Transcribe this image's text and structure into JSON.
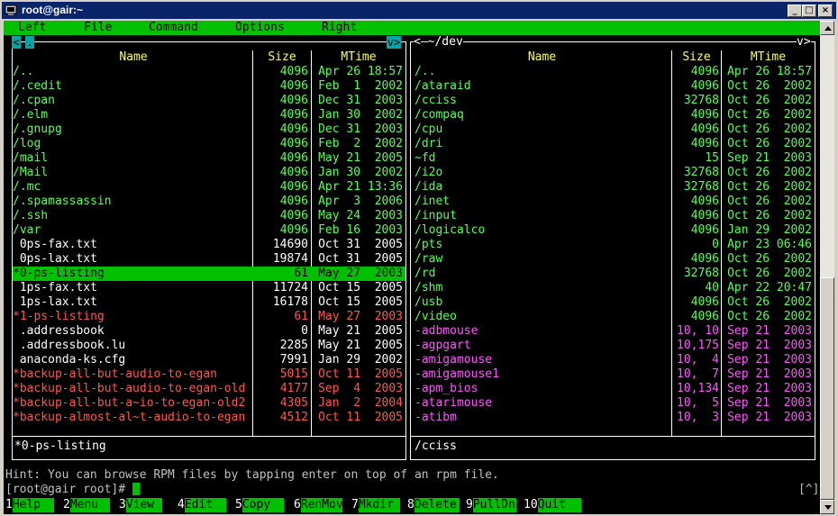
{
  "window": {
    "title": "root@gair:~",
    "buttons": {
      "minimize": "_",
      "maximize": "□",
      "close": "×"
    }
  },
  "menu": [
    "Left",
    "File",
    "Command",
    "Options",
    "Right"
  ],
  "left_panel": {
    "path": "",
    "header": {
      "name": "Name",
      "size": "Size",
      "mtime": "MTime"
    },
    "files": [
      {
        "name": "/..",
        "size": "4096",
        "mtime": "Apr 26 18:57",
        "type": "dir"
      },
      {
        "name": "/.cedit",
        "size": "4096",
        "mtime": "Feb  1  2002",
        "type": "dir"
      },
      {
        "name": "/.cpan",
        "size": "4096",
        "mtime": "Dec 31  2003",
        "type": "dir"
      },
      {
        "name": "/.elm",
        "size": "4096",
        "mtime": "Jan 30  2002",
        "type": "dir"
      },
      {
        "name": "/.gnupg",
        "size": "4096",
        "mtime": "Dec 31  2003",
        "type": "dir"
      },
      {
        "name": "/log",
        "size": "4096",
        "mtime": "Feb  2  2002",
        "type": "dir"
      },
      {
        "name": "/mail",
        "size": "4096",
        "mtime": "May 21  2005",
        "type": "dir"
      },
      {
        "name": "/Mail",
        "size": "4096",
        "mtime": "Jan 30  2002",
        "type": "dir"
      },
      {
        "name": "/.mc",
        "size": "4096",
        "mtime": "Apr 21 13:36",
        "type": "dir"
      },
      {
        "name": "/.spamassassin",
        "size": "4096",
        "mtime": "Apr  3  2006",
        "type": "dir"
      },
      {
        "name": "/.ssh",
        "size": "4096",
        "mtime": "May 24  2003",
        "type": "dir"
      },
      {
        "name": "/var",
        "size": "4096",
        "mtime": "Feb 16  2003",
        "type": "dir"
      },
      {
        "name": " 0ps-fax.txt",
        "size": "14690",
        "mtime": "Oct 31  2005",
        "type": "file"
      },
      {
        "name": " 0ps-lax.txt",
        "size": "19874",
        "mtime": "Oct 31  2005",
        "type": "file"
      },
      {
        "name": "*0-ps-listing",
        "size": "61",
        "mtime": "May 27  2003",
        "type": "selected"
      },
      {
        "name": " 1ps-fax.txt",
        "size": "11724",
        "mtime": "Oct 15  2005",
        "type": "file"
      },
      {
        "name": " 1ps-lax.txt",
        "size": "16178",
        "mtime": "Oct 15  2005",
        "type": "file"
      },
      {
        "name": "*1-ps-listing",
        "size": "61",
        "mtime": "May 27  2003",
        "type": "exec"
      },
      {
        "name": " .addressbook",
        "size": "0",
        "mtime": "May 21  2005",
        "type": "file"
      },
      {
        "name": " .addressbook.lu",
        "size": "2285",
        "mtime": "May 21  2005",
        "type": "file"
      },
      {
        "name": " anaconda-ks.cfg",
        "size": "7991",
        "mtime": "Jan 29  2002",
        "type": "file"
      },
      {
        "name": "*backup-all-but-audio-to-egan",
        "size": "5015",
        "mtime": "Oct 11  2005",
        "type": "exec"
      },
      {
        "name": "*backup-all-but-audio-to-egan-old",
        "size": "4177",
        "mtime": "Sep  4  2003",
        "type": "exec"
      },
      {
        "name": "*backup-all-but-a~io-to-egan-old2",
        "size": "4305",
        "mtime": "Jan  2  2004",
        "type": "exec"
      },
      {
        "name": "*backup-almost-al~t-audio-to-egan",
        "size": "4512",
        "mtime": "Oct 11  2005",
        "type": "exec"
      }
    ],
    "status": "*0-ps-listing"
  },
  "right_panel": {
    "path": "~/dev",
    "header": {
      "name": "Name",
      "size": "Size",
      "mtime": "MTime"
    },
    "files": [
      {
        "name": "/..",
        "size": "4096",
        "mtime": "Apr 26 18:57",
        "type": "dir"
      },
      {
        "name": "/ataraid",
        "size": "4096",
        "mtime": "Oct 26  2002",
        "type": "dir"
      },
      {
        "name": "/cciss",
        "size": "32768",
        "mtime": "Oct 26  2002",
        "type": "dir"
      },
      {
        "name": "/compaq",
        "size": "4096",
        "mtime": "Oct 26  2002",
        "type": "dir"
      },
      {
        "name": "/cpu",
        "size": "4096",
        "mtime": "Oct 26  2002",
        "type": "dir"
      },
      {
        "name": "/dri",
        "size": "4096",
        "mtime": "Oct 26  2002",
        "type": "dir"
      },
      {
        "name": "~fd",
        "size": "15",
        "mtime": "Sep 21  2003",
        "type": "dir"
      },
      {
        "name": "/i2o",
        "size": "32768",
        "mtime": "Oct 26  2002",
        "type": "dir"
      },
      {
        "name": "/ida",
        "size": "32768",
        "mtime": "Oct 26  2002",
        "type": "dir"
      },
      {
        "name": "/inet",
        "size": "4096",
        "mtime": "Oct 26  2002",
        "type": "dir"
      },
      {
        "name": "/input",
        "size": "4096",
        "mtime": "Oct 26  2002",
        "type": "dir"
      },
      {
        "name": "/logicalco",
        "size": "4096",
        "mtime": "Jan 29  2002",
        "type": "dir"
      },
      {
        "name": "/pts",
        "size": "0",
        "mtime": "Apr 23 06:46",
        "type": "dir"
      },
      {
        "name": "/raw",
        "size": "4096",
        "mtime": "Oct 26  2002",
        "type": "dir"
      },
      {
        "name": "/rd",
        "size": "32768",
        "mtime": "Oct 26  2002",
        "type": "dir"
      },
      {
        "name": "/shm",
        "size": "40",
        "mtime": "Apr 22 20:47",
        "type": "dir"
      },
      {
        "name": "/usb",
        "size": "4096",
        "mtime": "Oct 26  2002",
        "type": "dir"
      },
      {
        "name": "/video",
        "size": "4096",
        "mtime": "Oct 26  2002",
        "type": "dir"
      },
      {
        "name": "-adbmouse",
        "size": "10, 10",
        "mtime": "Sep 21  2003",
        "type": "dev"
      },
      {
        "name": "-agpgart",
        "size": "10,175",
        "mtime": "Sep 21  2003",
        "type": "dev"
      },
      {
        "name": "-amigamouse",
        "size": "10,  4",
        "mtime": "Sep 21  2003",
        "type": "dev"
      },
      {
        "name": "-amigamouse1",
        "size": "10,  7",
        "mtime": "Sep 21  2003",
        "type": "dev"
      },
      {
        "name": "-apm_bios",
        "size": "10,134",
        "mtime": "Sep 21  2003",
        "type": "dev"
      },
      {
        "name": "-atarimouse",
        "size": "10,  5",
        "mtime": "Sep 21  2003",
        "type": "dev"
      },
      {
        "name": "-atibm",
        "size": "10,  3",
        "mtime": "Sep 21  2003",
        "type": "dev"
      }
    ],
    "status": "/cciss"
  },
  "hint": "Hint: You can browse RPM files by tapping enter on top of an rpm file.",
  "prompt": "[root@gair root]# ",
  "prompt_right": "[^]",
  "fkeys": [
    {
      "num": "1",
      "label": "Help"
    },
    {
      "num": "2",
      "label": "Menu"
    },
    {
      "num": "3",
      "label": "View"
    },
    {
      "num": "4",
      "label": "Edit"
    },
    {
      "num": "5",
      "label": "Copy"
    },
    {
      "num": "6",
      "label": "RenMov"
    },
    {
      "num": "7",
      "label": "Mkdir"
    },
    {
      "num": "8",
      "label": "Delete"
    },
    {
      "num": "9",
      "label": "PullDn"
    },
    {
      "num": "10",
      "label": "Quit"
    }
  ],
  "colors": {
    "dir": "#55ff55",
    "file": "#ffffff",
    "exec": "#ff5555",
    "dev": "#ff55ff",
    "selected_bg": "#00c000",
    "header": "#ffff55",
    "menubar": "#00c000"
  }
}
